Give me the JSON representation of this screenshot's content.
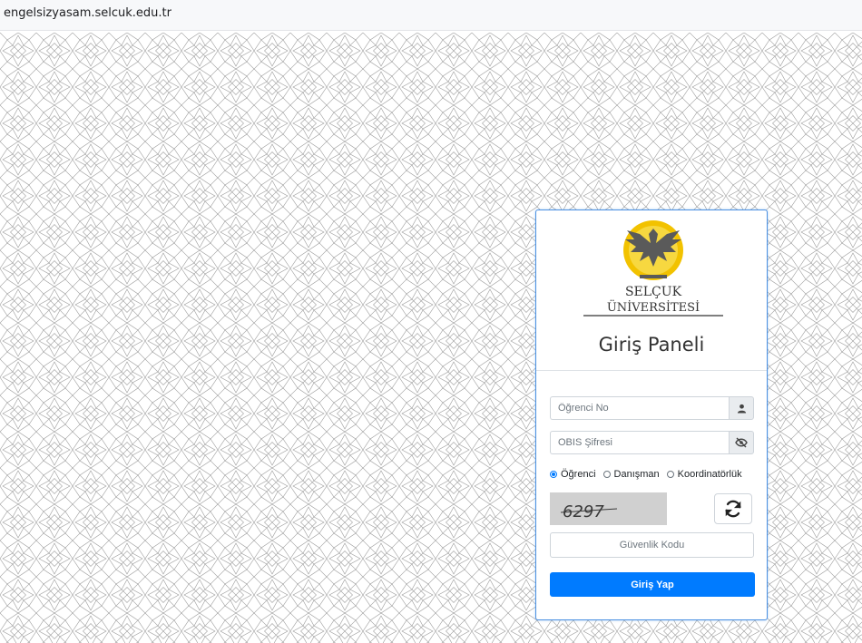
{
  "browser": {
    "url": "engelsizyasam.selcuk.edu.tr"
  },
  "logo": {
    "line1": "SELÇUK",
    "line2": "ÜNİVERSİTESİ"
  },
  "panel": {
    "title": "Giriş Paneli",
    "student_no_placeholder": "Öğrenci No",
    "password_placeholder": "OBIS Şifresi",
    "roles": [
      {
        "label": "Öğrenci",
        "checked": true
      },
      {
        "label": "Danışman",
        "checked": false
      },
      {
        "label": "Koordinatörlük",
        "checked": false
      }
    ],
    "captcha_text": "6297",
    "security_code_placeholder": "Güvenlik Kodu",
    "login_label": "Giriş Yap"
  },
  "colors": {
    "primary": "#007bff",
    "panel_border": "#4a90e2",
    "logo_gold": "#f2c200"
  }
}
